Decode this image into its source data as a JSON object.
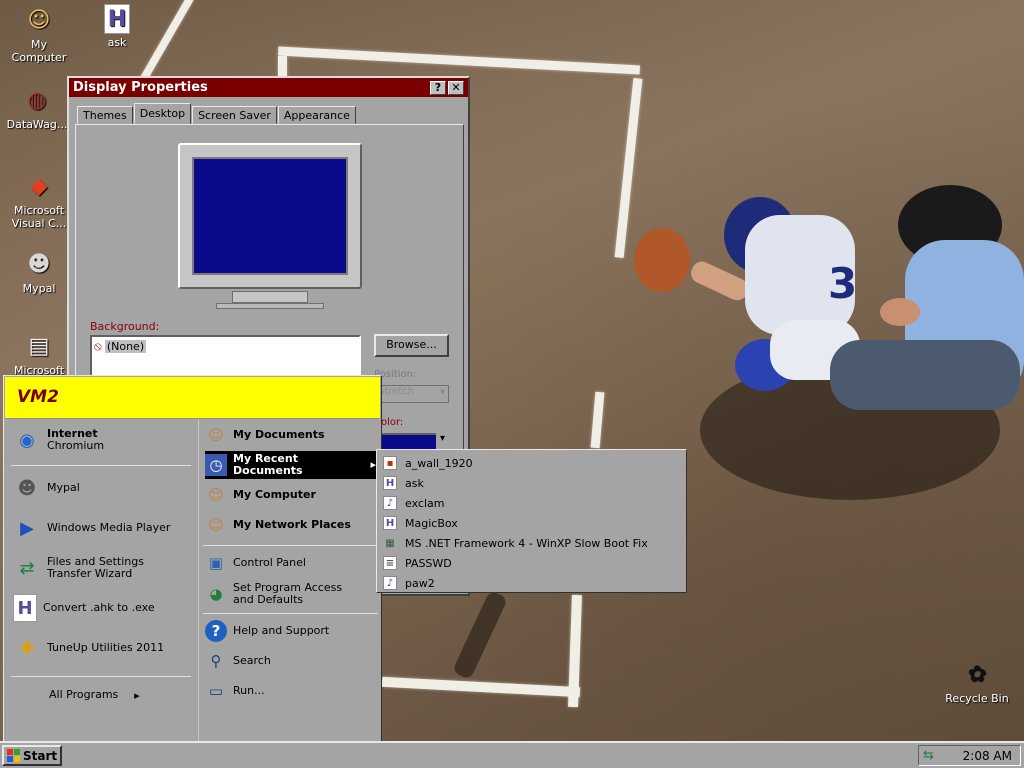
{
  "desktop": {
    "icons": [
      {
        "label": "My\nComputer",
        "glyph": "☺",
        "icon": "my-computer-icon"
      },
      {
        "label": "ask",
        "glyph": "H",
        "icon": "ahk-script-icon"
      },
      {
        "label": "DataWag...",
        "glyph": "◍",
        "icon": "datawag-icon"
      },
      {
        "label": "Microsoft\nVisual C...",
        "glyph": "◆",
        "icon": "visual-studio-icon"
      },
      {
        "label": "Mypal",
        "glyph": "☻",
        "icon": "mypal-icon"
      },
      {
        "label": "Microsoft",
        "glyph": "▤",
        "icon": "microsoft-icon"
      },
      {
        "label": "Recycle Bin",
        "glyph": "✿",
        "icon": "recycle-bin-icon"
      }
    ]
  },
  "window": {
    "title": "Display Properties",
    "help_btn": "?",
    "close_btn": "✕",
    "tabs": [
      "Themes",
      "Desktop",
      "Screen Saver",
      "Appearance"
    ],
    "background_label": "Background:",
    "background_items": [
      "(None)"
    ],
    "browse_label": "Browse...",
    "position_label": "Position:",
    "position_value": "Stretch",
    "color_label": "Color:",
    "dropdown_arrow": "▾"
  },
  "startmenu": {
    "user": "VM2",
    "left_items": [
      {
        "title": "Internet",
        "sub": "Chromium",
        "icon": "chromium-icon"
      },
      {
        "title": "Mypal",
        "icon": "mypal-icon"
      },
      {
        "title": "Windows Media Player",
        "icon": "media-player-icon"
      },
      {
        "title": "Files and Settings\nTransfer Wizard",
        "icon": "transfer-wizard-icon"
      },
      {
        "title": "Convert .ahk to .exe",
        "icon": "ahk-convert-icon"
      },
      {
        "title": "TuneUp Utilities 2011",
        "icon": "tuneup-icon"
      }
    ],
    "all_programs": "All Programs",
    "arrow": "▸",
    "right_items": [
      {
        "title": "My Documents",
        "icon": "my-documents-icon"
      },
      {
        "title": "My Recent\nDocuments",
        "icon": "recent-documents-icon"
      },
      {
        "title": "My Computer",
        "icon": "my-computer-icon"
      },
      {
        "title": "My Network Places",
        "icon": "network-places-icon"
      },
      {
        "title": "Control Panel",
        "icon": "control-panel-icon"
      },
      {
        "title": "Set Program Access\nand Defaults",
        "icon": "program-defaults-icon"
      },
      {
        "title": "Help and Support",
        "icon": "help-icon"
      },
      {
        "title": "Search",
        "icon": "search-icon"
      },
      {
        "title": "Run...",
        "icon": "run-icon"
      }
    ]
  },
  "recent_docs": [
    {
      "name": "a_wall_1920",
      "icon": "image-file-icon"
    },
    {
      "name": "ask",
      "icon": "ahk-file-icon"
    },
    {
      "name": "exclam",
      "icon": "sound-file-icon"
    },
    {
      "name": "MagicBox",
      "icon": "ahk-file-icon"
    },
    {
      "name": "MS .NET Framework 4 - WinXP Slow Boot Fix",
      "icon": "registry-file-icon"
    },
    {
      "name": "PASSWD",
      "icon": "text-file-icon"
    },
    {
      "name": "paw2",
      "icon": "sound-file-icon"
    }
  ],
  "taskbar": {
    "start_label": "Start",
    "clock": "2:08 AM"
  },
  "colors": {
    "title_bar": "#7a0000",
    "start_header": "#ffff00",
    "preview_screen": "#0a0a8a",
    "highlight": "#000000"
  }
}
